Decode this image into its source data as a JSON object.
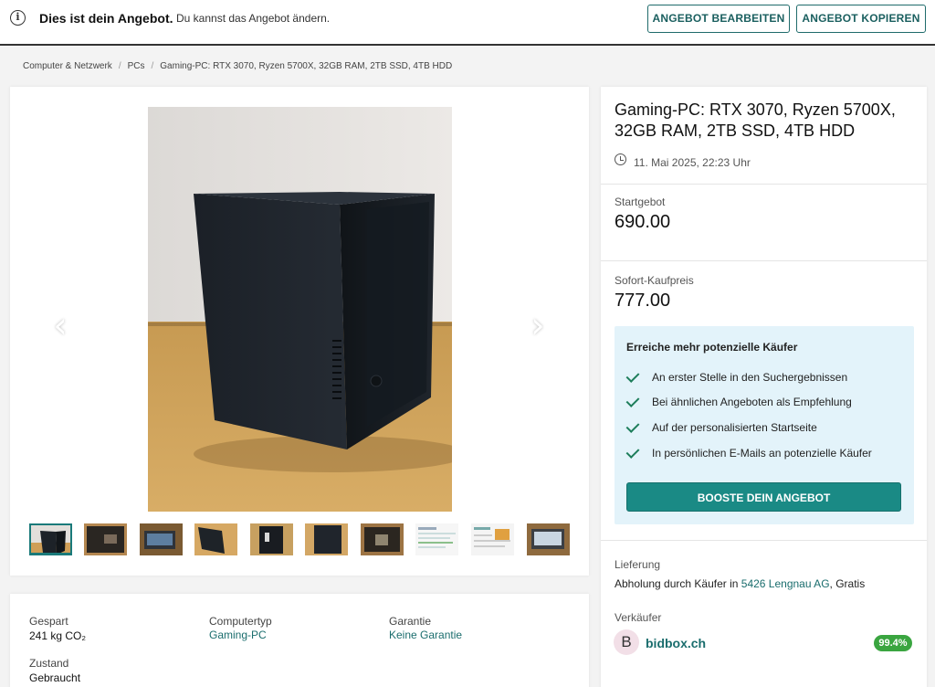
{
  "topbar": {
    "title": "Dies ist dein Angebot.",
    "subtitle": "Du kannst das Angebot ändern.",
    "edit_label": "ANGEBOT BEARBEITEN",
    "copy_label": "ANGEBOT KOPIEREN"
  },
  "breadcrumb": [
    "Computer & Netzwerk",
    "PCs",
    "Gaming-PC: RTX 3070, Ryzen 5700X, 32GB RAM, 2TB SSD, 4TB HDD"
  ],
  "details": {
    "saved_label": "Gespart",
    "saved_value": "241 kg CO₂",
    "type_label": "Computertyp",
    "type_value": "Gaming-PC",
    "warranty_label": "Garantie",
    "warranty_value": "Keine Garantie",
    "condition_label": "Zustand",
    "condition_value": "Gebraucht"
  },
  "listing": {
    "title": "Gaming-PC: RTX 3070, Ryzen 5700X, 32GB RAM, 2TB SSD, 4TB HDD",
    "date": "11. Mai 2025, 22:23 Uhr",
    "start_label": "Startgebot",
    "start_price": "690.00",
    "buynow_label": "Sofort-Kaufpreis",
    "buynow_price": "777.00"
  },
  "boost": {
    "title": "Erreiche mehr potenzielle Käufer",
    "items": [
      "An erster Stelle in den Suchergebnissen",
      "Bei ähnlichen Angeboten als Empfehlung",
      "Auf der personalisierten Startseite",
      "In persönlichen E-Mails an potenzielle Käufer"
    ],
    "button": "BOOSTE DEIN ANGEBOT"
  },
  "delivery": {
    "label": "Lieferung",
    "prefix": "Abholung durch Käufer in ",
    "location": "5426 Lengnau AG",
    "suffix": ", Gratis"
  },
  "seller": {
    "label": "Verkäufer",
    "initial": "B",
    "name": "bidbox.ch",
    "rating": "99.4%"
  },
  "colors": {
    "accent": "#1a8a85",
    "link": "#1a6d6d",
    "boost_bg": "#e3f3fa",
    "rating": "#3aa540"
  }
}
